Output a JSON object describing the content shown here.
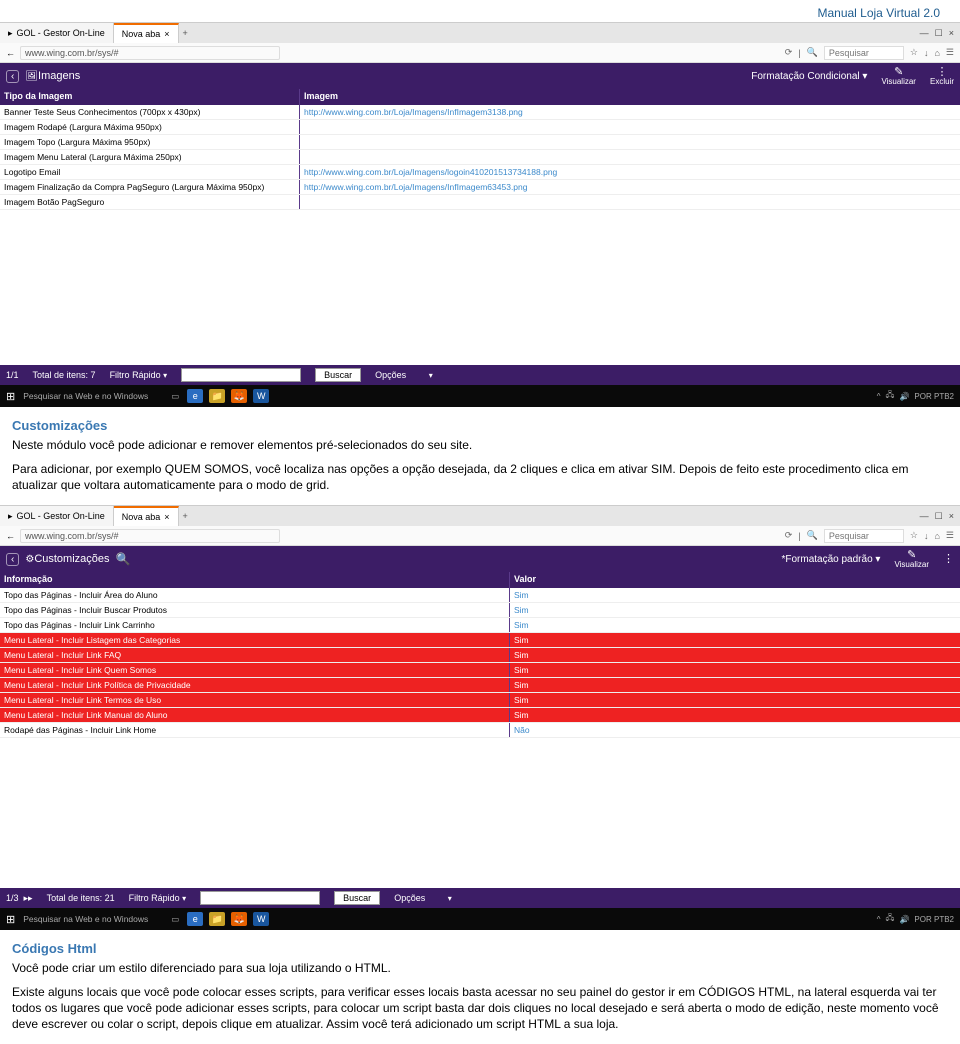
{
  "doc_title": "Manual Loja Virtual 2.0",
  "browser": {
    "tab1": "GOL - Gestor On-Line",
    "tab2": "Nova aba",
    "url": "www.wing.com.br/sys/#",
    "search_placeholder": "Pesquisar"
  },
  "screenshot1": {
    "title": "Imagens",
    "format_label": "Formatação Condicional",
    "action1": "Visualizar",
    "action2": "Excluir",
    "col1": "Tipo da Imagem",
    "col2": "Imagem",
    "rows": [
      {
        "a": "Banner Teste Seus Conhecimentos (700px x 430px)",
        "b": "http://www.wing.com.br/Loja/Imagens/InfImagem3138.png"
      },
      {
        "a": "Imagem Rodapé (Largura Máxima 950px)",
        "b": ""
      },
      {
        "a": "Imagem Topo (Largura Máxima 950px)",
        "b": ""
      },
      {
        "a": "Imagem Menu Lateral (Largura Máxima 250px)",
        "b": ""
      },
      {
        "a": "Logotipo Email",
        "b": "http://www.wing.com.br/Loja/Imagens/logoin410201513734188.png"
      },
      {
        "a": "Imagem Finalização da Compra PagSeguro (Largura Máxima 950px)",
        "b": "http://www.wing.com.br/Loja/Imagens/InfImagem63453.png"
      },
      {
        "a": "Imagem Botão PagSeguro",
        "b": ""
      }
    ],
    "page_info": "1/1",
    "total": "Total de itens: 7",
    "filtro": "Filtro Rápido",
    "buscar": "Buscar",
    "opcoes": "Opções"
  },
  "text1": {
    "heading": "Customizações",
    "p1": "Neste módulo você pode adicionar e remover elementos pré-selecionados do seu site.",
    "p2": "Para adicionar, por exemplo QUEM SOMOS, você localiza nas opções a opção desejada, da 2 cliques e clica em ativar SIM. Depois de feito este procedimento clica em atualizar que voltara automaticamente para o modo de grid."
  },
  "screenshot2": {
    "title": "Customizações",
    "format_label": "*Formatação padrão",
    "action1": "Visualizar",
    "col1": "Informação",
    "col2": "Valor",
    "rows": [
      {
        "a": "Topo das Páginas - Incluir Área do Aluno",
        "b": "Sim",
        "red": false
      },
      {
        "a": "Topo das Páginas - Incluir Buscar Produtos",
        "b": "Sim",
        "red": false
      },
      {
        "a": "Topo das Páginas - Incluir Link Carrinho",
        "b": "Sim",
        "red": false
      },
      {
        "a": "Menu Lateral - Incluir Listagem das Categorias",
        "b": "Sim",
        "red": true
      },
      {
        "a": "Menu Lateral - Incluir Link FAQ",
        "b": "Sim",
        "red": true
      },
      {
        "a": "Menu Lateral - Incluir Link Quem Somos",
        "b": "Sim",
        "red": true
      },
      {
        "a": "Menu Lateral - Incluir Link Política de Privacidade",
        "b": "Sim",
        "red": true
      },
      {
        "a": "Menu Lateral - Incluir Link Termos de Uso",
        "b": "Sim",
        "red": true
      },
      {
        "a": "Menu Lateral - Incluir Link Manual do Aluno",
        "b": "Sim",
        "red": true
      },
      {
        "a": "Rodapé das Páginas - Incluir Link Home",
        "b": "Não",
        "red": false
      }
    ],
    "page_info": "1/3",
    "total": "Total de itens: 21",
    "filtro": "Filtro Rápido",
    "buscar": "Buscar",
    "opcoes": "Opções"
  },
  "text2": {
    "heading": "Códigos Html",
    "p1": "Você pode criar um estilo diferenciado para sua loja utilizando o HTML.",
    "p2": "Existe alguns locais que você pode colocar esses scripts, para verificar esses locais basta acessar no seu painel do gestor ir em CÓDIGOS HTML,  na lateral esquerda vai ter todos os lugares que você pode adicionar esses scripts, para colocar um script basta dar dois cliques no local desejado e será aberta o modo de edição, neste momento você deve escrever ou colar o script, depois clique em atualizar. Assim você terá adicionado um script HTML a sua loja."
  },
  "taskbar": {
    "search": "Pesquisar na Web e no Windows",
    "lang": "POR PTB2"
  }
}
